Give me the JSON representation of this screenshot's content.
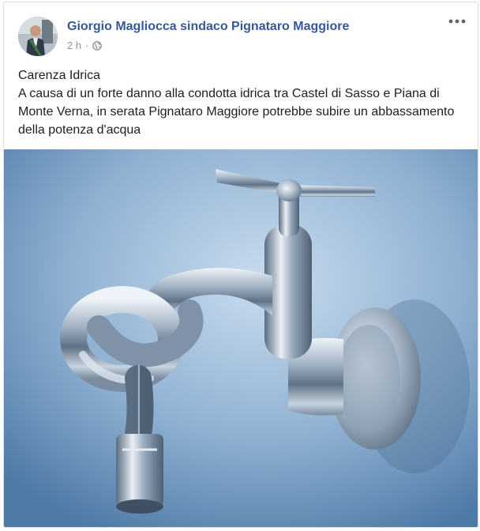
{
  "post": {
    "author": "Giorgio Magliocca sindaco Pignataro Maggiore",
    "time": "2 h",
    "separator": "·",
    "privacy_icon": "globe-icon",
    "more_icon": "more-options-icon",
    "text_title": "Carenza Idrica",
    "text_body": "A causa di un forte danno alla condotta idrica tra Castel di Sasso e Piana di Monte Verna, in serata Pignataro Maggiore potrebbe subire un abbassamento della potenza d'acqua"
  },
  "colors": {
    "author_link": "#365899",
    "meta_text": "#90949c",
    "card_border": "#dddfe2",
    "photo_background": "#7fa2c4"
  }
}
